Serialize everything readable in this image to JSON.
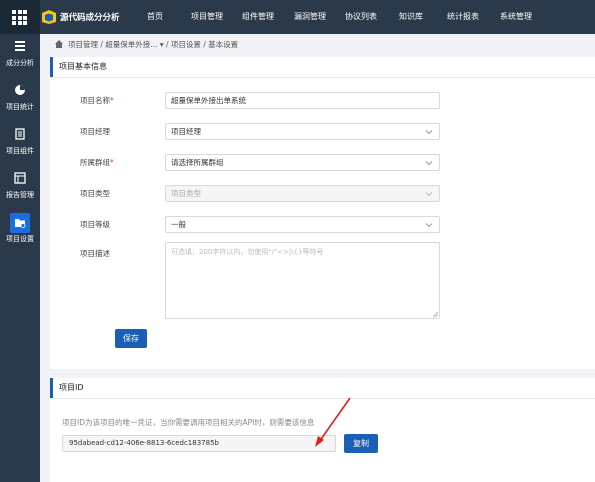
{
  "topbar": {
    "app_title": "源代码成分分析",
    "nav": [
      "首页",
      "项目管理",
      "组件管理",
      "漏洞管理",
      "协议列表",
      "知识库",
      "统计报表",
      "系统管理"
    ]
  },
  "sidebar": {
    "items": [
      {
        "label": "成分分析",
        "icon": "list-icon"
      },
      {
        "label": "项目统计",
        "icon": "pie-chart-icon"
      },
      {
        "label": "项目组件",
        "icon": "document-icon"
      },
      {
        "label": "报告管理",
        "icon": "report-icon"
      },
      {
        "label": "项目设置",
        "icon": "folder-settings-icon",
        "active": true
      }
    ]
  },
  "breadcrumb": "项目管理 / 超量保单外接... ▾ / 项目设置 / 基本设置",
  "basic_info": {
    "title": "项目基本信息",
    "fields": {
      "name_label": "项目名称",
      "name_value": "超量保单外接出单系统",
      "manager_label": "项目经理",
      "manager_value": "项目经理",
      "group_label": "所属群组",
      "group_value": "请选择所属群组",
      "type_label": "项目类型",
      "type_placeholder": "项目类型",
      "level_label": "项目等级",
      "level_value": "一般",
      "desc_label": "项目描述",
      "desc_placeholder": "可选填，200字符以内，勿使用\"/\"<>|\\{}等符号"
    },
    "save_label": "保存"
  },
  "project_id": {
    "title": "项目ID",
    "hint": "项目ID为该项目的唯一凭证，当你需要调用项目相关的API时，则需要该信息",
    "value": "95dabead-cd12-406e-8813-6cedc183785b",
    "copy_label": "复制"
  },
  "colors": {
    "topbar": "#2b3a4a",
    "accent": "#1a5fb4",
    "annotation_arrow": "#e02020"
  }
}
